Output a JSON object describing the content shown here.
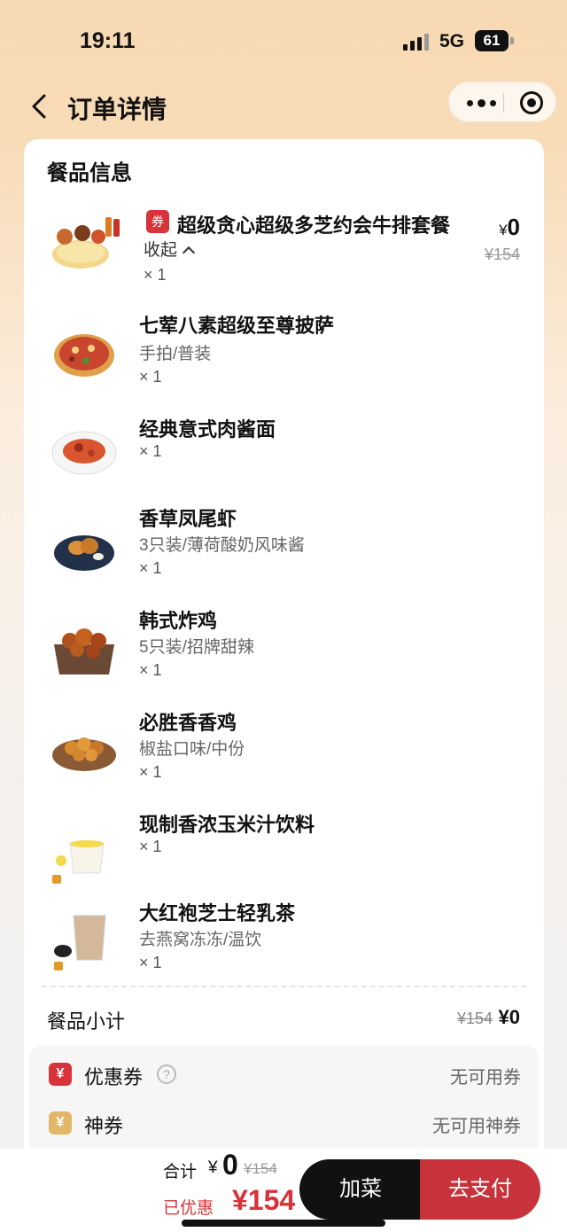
{
  "status_bar": {
    "time": "19:11",
    "network": "5G",
    "battery": "61"
  },
  "nav": {
    "title": "订单详情"
  },
  "order": {
    "section_title": "餐品信息",
    "combo": {
      "tag": "券",
      "name": "超级贪心超级多芝约会牛排套餐",
      "collapse_label": "收起",
      "qty": "× 1",
      "price_now_symbol": "¥",
      "price_now": "0",
      "price_old": "¥154"
    },
    "items": [
      {
        "name": "七荤八素超级至尊披萨",
        "spec": "手拍/普装",
        "qty": "× 1"
      },
      {
        "name": "经典意式肉酱面",
        "spec": "",
        "qty": "× 1"
      },
      {
        "name": "香草凤尾虾",
        "spec": "3只装/薄荷酸奶风味酱",
        "qty": "× 1"
      },
      {
        "name": "韩式炸鸡",
        "spec": "5只装/招牌甜辣",
        "qty": "× 1"
      },
      {
        "name": "必胜香香鸡",
        "spec": "椒盐口味/中份",
        "qty": "× 1"
      },
      {
        "name": "现制香浓玉米汁饮料",
        "spec": "",
        "qty": "× 1"
      },
      {
        "name": "大红袍芝士轻乳茶",
        "spec": "去燕窝冻冻/温饮",
        "qty": "× 1"
      }
    ],
    "subtotal": {
      "label": "餐品小计",
      "old": "¥154",
      "now": "¥0"
    },
    "discounts": [
      {
        "icon": "¥",
        "label": "优惠券",
        "value": "无可用券",
        "color": "#d8333a"
      },
      {
        "icon": "¥",
        "label": "神券",
        "value": "无可用神券",
        "color": "#e2b76a"
      }
    ]
  },
  "bottom_bar": {
    "total_label": "合计",
    "total_symbol": "¥",
    "total_now": "0",
    "total_old": "¥154",
    "saved_label": "已优惠",
    "saved_value": "¥154",
    "add_button": "加菜",
    "pay_button": "去支付"
  }
}
